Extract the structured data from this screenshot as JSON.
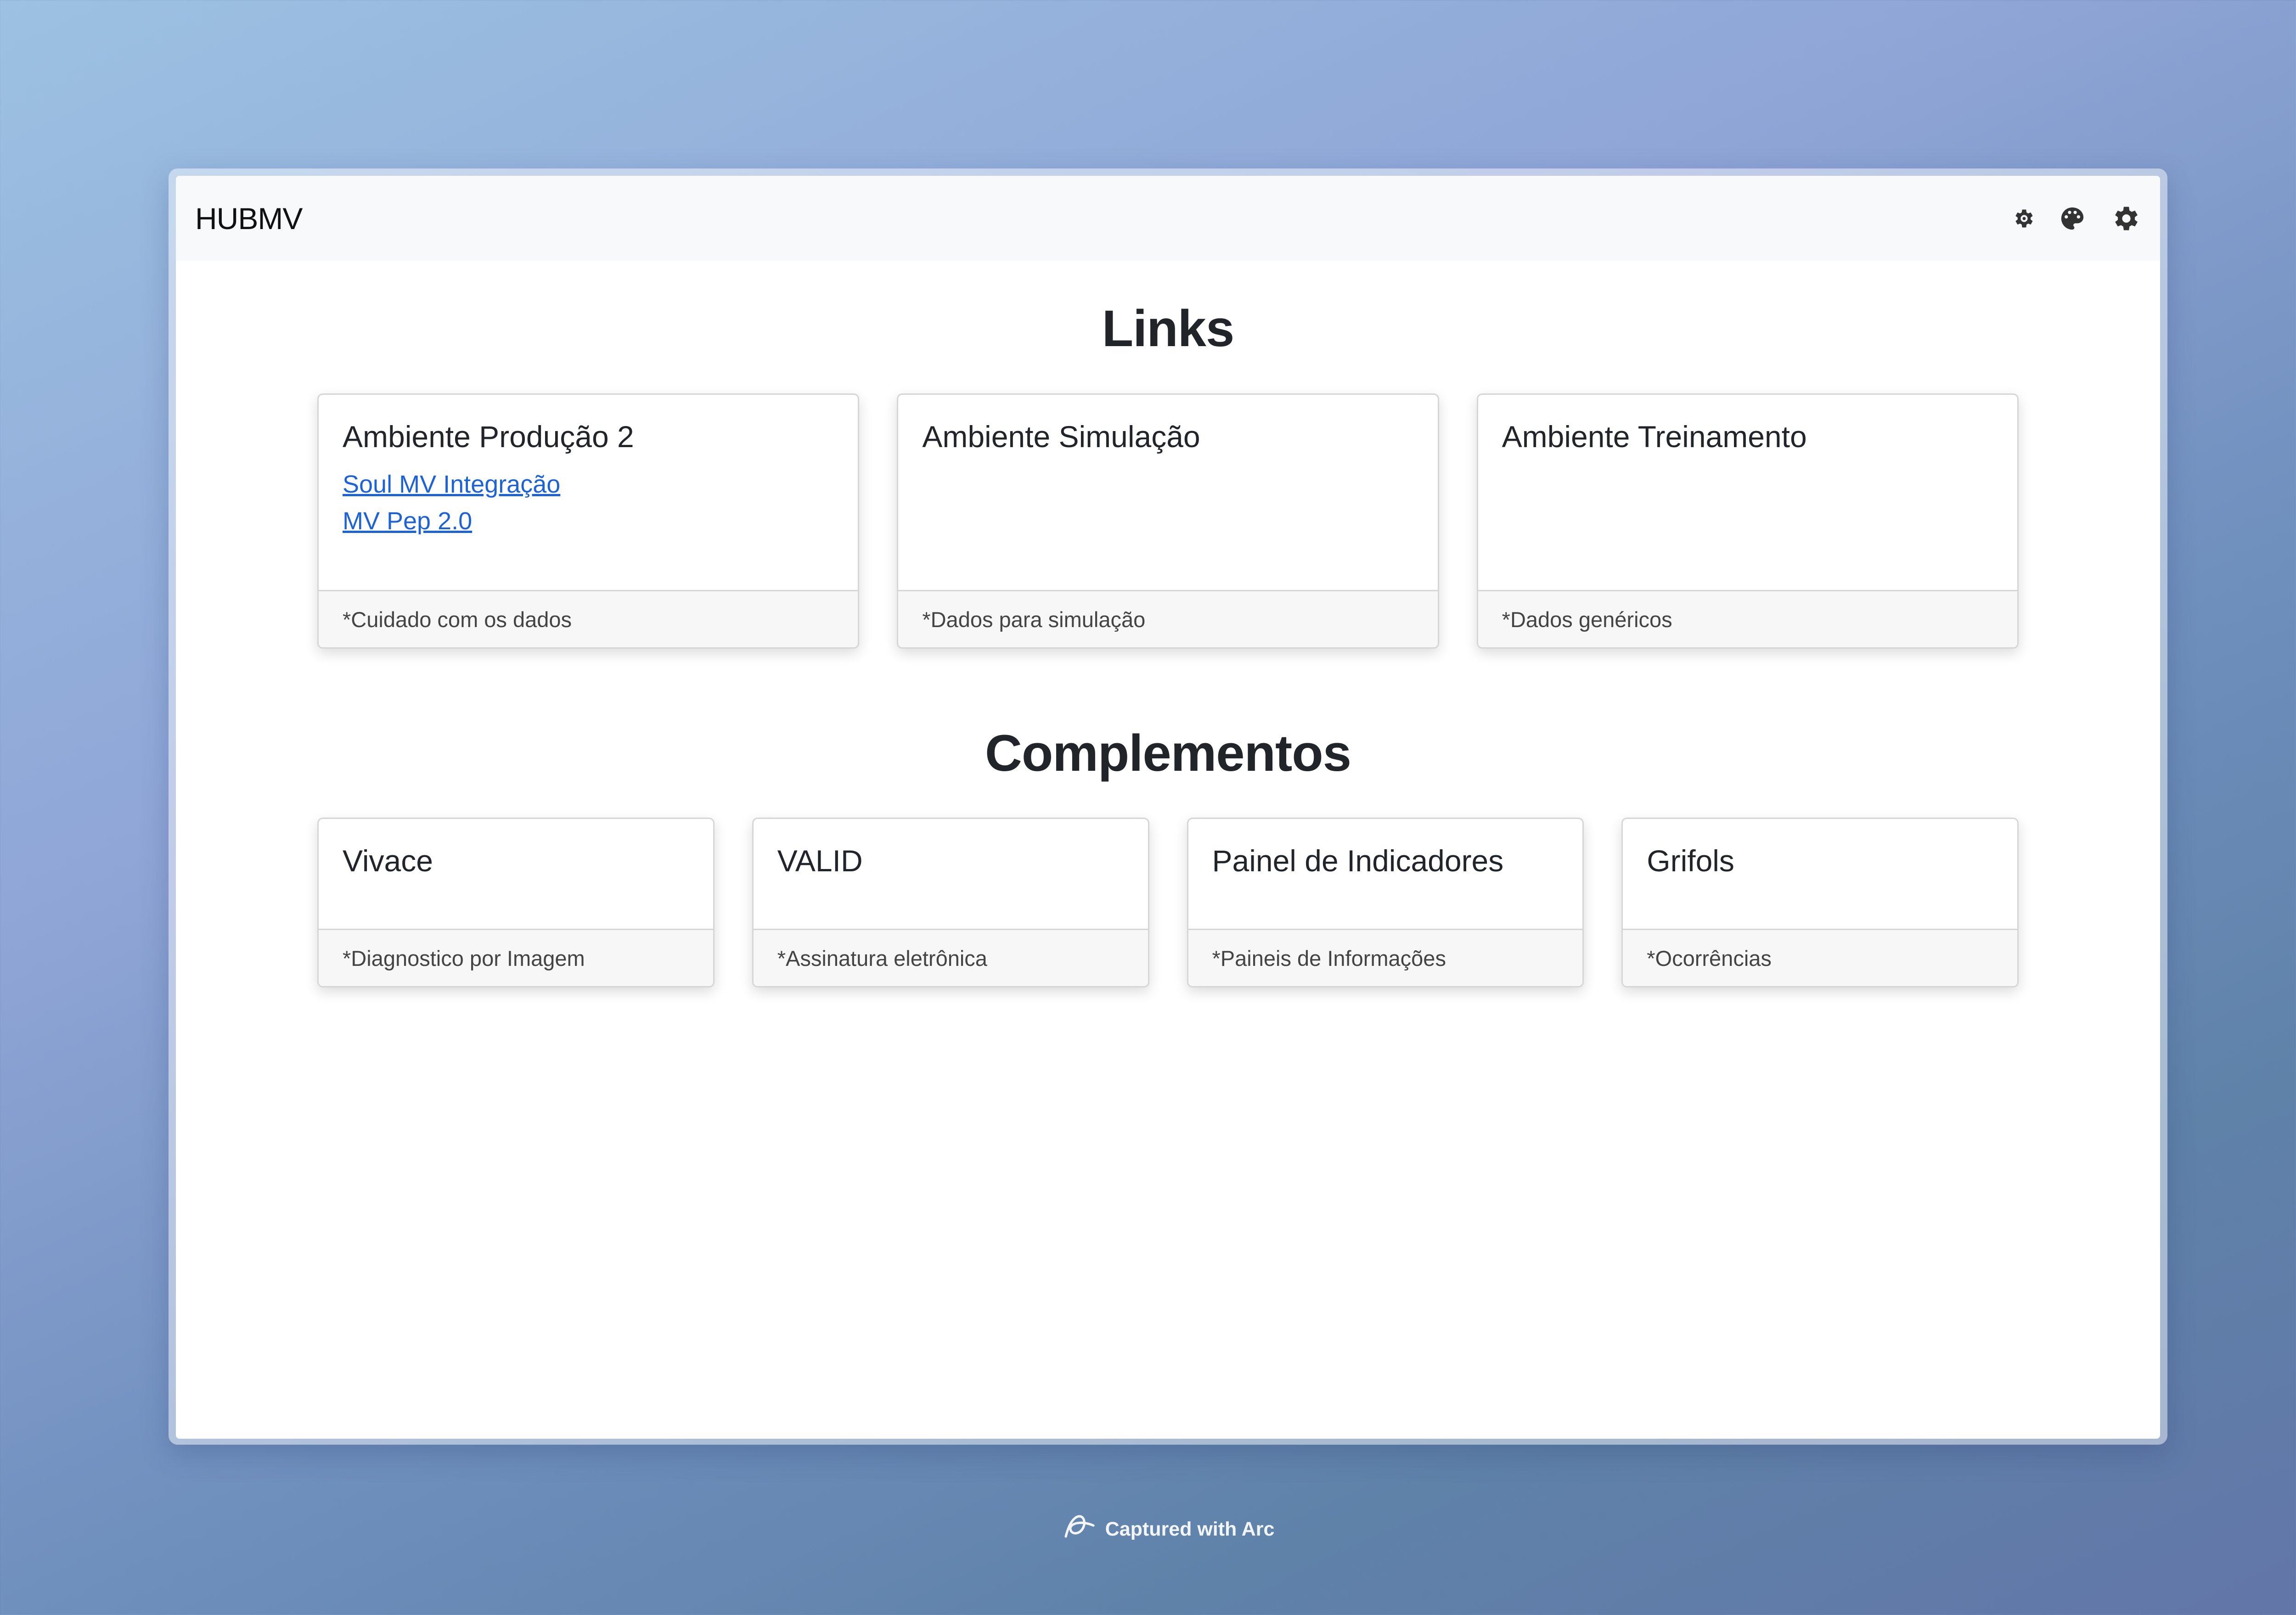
{
  "app": {
    "brand": "HUBMV",
    "icons": [
      "gear-small-icon",
      "palette-icon",
      "gear-icon"
    ]
  },
  "links_section": {
    "title": "Links",
    "cards": [
      {
        "title": "Ambiente Produção 2",
        "links": [
          "Soul MV Integração",
          "MV Pep 2.0"
        ],
        "footer": "*Cuidado com os dados"
      },
      {
        "title": "Ambiente Simulação",
        "footer": "*Dados para simulação"
      },
      {
        "title": "Ambiente Treinamento",
        "footer": "*Dados genéricos"
      }
    ]
  },
  "complementos_section": {
    "title": "Complementos",
    "cards": [
      {
        "title": "Vivace",
        "footer": "*Diagnostico por Imagem"
      },
      {
        "title": "VALID",
        "footer": "*Assinatura eletrônica"
      },
      {
        "title": "Painel de Indicadores",
        "footer": "*Paineis de Informações"
      },
      {
        "title": "Grifols",
        "footer": "*Ocorrências"
      }
    ]
  },
  "watermark": {
    "text": "Captured with Arc"
  },
  "colors": {
    "link": "#1e63d6",
    "navbar_bg": "#f8f9fa",
    "card_footer_bg": "#f7f7f7"
  }
}
